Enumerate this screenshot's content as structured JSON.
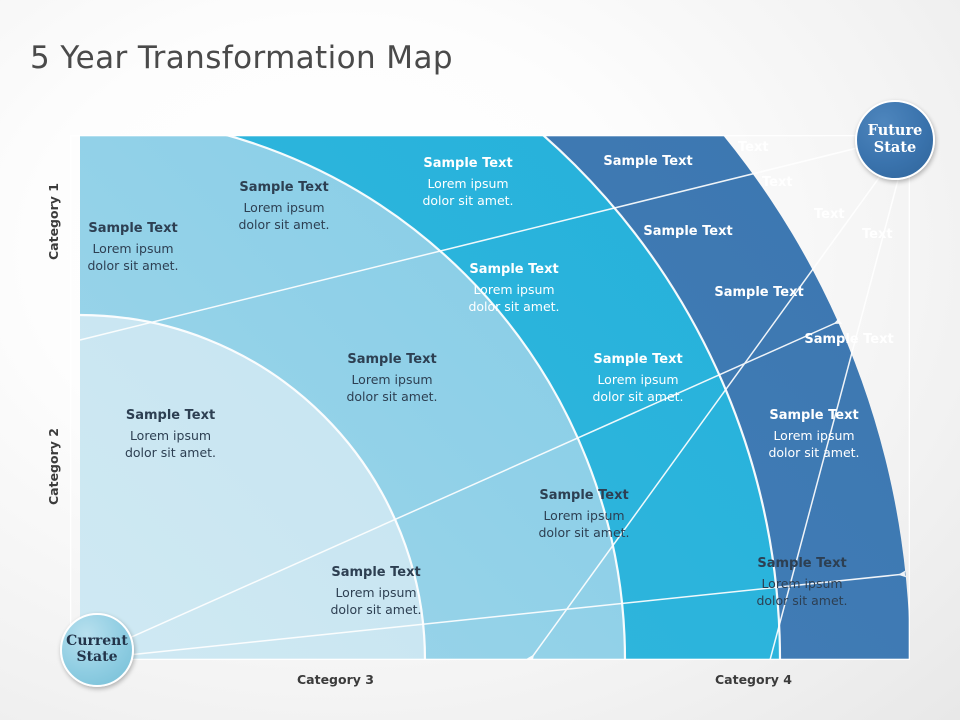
{
  "slide": {
    "title": "5 Year Transformation Map",
    "background_color": "#f2f2f2"
  },
  "theme": {
    "band_1_color": "#cbe7f2",
    "band_2_color": "#8dd0e8",
    "band_3_color": "#28b4dc",
    "band_4_color": "#3d79b4",
    "divider_color": "#ffffff",
    "title_color": "#4a4a4a",
    "dark_text_color": "#2d3f52",
    "light_text_color": "#ffffff"
  },
  "nodes": {
    "start": {
      "line1": "Current",
      "line2": "State"
    },
    "end": {
      "line1": "Future",
      "line2": "State"
    }
  },
  "axes": {
    "y": [
      {
        "label": "Category 1"
      },
      {
        "label": "Category 2"
      }
    ],
    "x": [
      {
        "label": "Category 3"
      },
      {
        "label": "Category 4"
      }
    ]
  },
  "labels": {
    "sample_title": "Sample Text",
    "sample_body_line1": "Lorem ipsum",
    "sample_body_line2": "dolor sit amet.",
    "short_label": "Text"
  },
  "items": [
    {
      "id": "b1-r1",
      "title": "Sample Text",
      "line1": "Lorem ipsum",
      "line2": "dolor sit amet.",
      "band": 1,
      "tone": "dark"
    },
    {
      "id": "b1-r2",
      "title": "Sample Text",
      "line1": "Lorem ipsum",
      "line2": "dolor sit amet.",
      "band": 1,
      "tone": "dark"
    },
    {
      "id": "b1-r3",
      "title": "Sample Text",
      "line1": "Lorem ipsum",
      "line2": "dolor sit amet.",
      "band": 1,
      "tone": "dark"
    },
    {
      "id": "b2-r1",
      "title": "Sample Text",
      "line1": "Lorem ipsum",
      "line2": "dolor sit amet.",
      "band": 2,
      "tone": "dark"
    },
    {
      "id": "b2-r2",
      "title": "Sample Text",
      "line1": "Lorem ipsum",
      "line2": "dolor sit amet.",
      "band": 2,
      "tone": "dark"
    },
    {
      "id": "b2-r3",
      "title": "Sample Text",
      "line1": "Lorem ipsum",
      "line2": "dolor sit amet.",
      "band": 2,
      "tone": "dark"
    },
    {
      "id": "b3-r1",
      "title": "Sample Text",
      "line1": "Lorem ipsum",
      "line2": "dolor sit amet.",
      "band": 3,
      "tone": "light"
    },
    {
      "id": "b3-r2",
      "title": "Sample Text",
      "line1": "Lorem ipsum",
      "line2": "dolor sit amet.",
      "band": 3,
      "tone": "light"
    },
    {
      "id": "b3-r3",
      "title": "Sample Text",
      "line1": "Lorem ipsum",
      "line2": "dolor sit amet.",
      "band": 3,
      "tone": "light"
    },
    {
      "id": "b3-r4",
      "title": "Sample Text",
      "line1": "Lorem ipsum",
      "line2": "dolor sit amet.",
      "band": 3,
      "tone": "light"
    },
    {
      "id": "b4-r1",
      "title": "Sample Text",
      "band": 4,
      "tone": "light"
    },
    {
      "id": "b4-r2",
      "title": "Sample Text",
      "band": 4,
      "tone": "light"
    },
    {
      "id": "b4-r3",
      "title": "Sample Text",
      "band": 4,
      "tone": "light"
    },
    {
      "id": "b4-r4",
      "title": "Sample Text",
      "band": 4,
      "tone": "light"
    },
    {
      "id": "t1",
      "title": "Text",
      "band": 4,
      "tone": "light"
    },
    {
      "id": "t2",
      "title": "Text",
      "band": 4,
      "tone": "light"
    },
    {
      "id": "t3",
      "title": "Text",
      "band": 4,
      "tone": "light"
    },
    {
      "id": "t4",
      "title": "Text",
      "band": 4,
      "tone": "light"
    }
  ],
  "chart_data": {
    "type": "pie",
    "title": "5 Year Transformation Map",
    "subtype": "concentric-quarter-arc radial roadmap",
    "origin": "bottom-left (Current State)",
    "destination": "top-right (Future State)",
    "bands": [
      {
        "index": 1,
        "color": "#cbe7f2",
        "inner_radius": 0,
        "outer_radius": 345
      },
      {
        "index": 2,
        "color": "#8dd0e8",
        "inner_radius": 345,
        "outer_radius": 545
      },
      {
        "index": 3,
        "color": "#28b4dc",
        "inner_radius": 545,
        "outer_radius": 700
      },
      {
        "index": 4,
        "color": "#3d79b4",
        "inner_radius": 700,
        "outer_radius": 830
      }
    ],
    "radial_dividers_deg": [
      6,
      24,
      44,
      66,
      84
    ],
    "legend": [],
    "grid": false
  }
}
